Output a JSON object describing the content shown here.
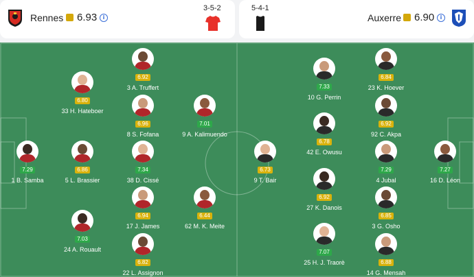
{
  "home": {
    "name": "Rennes",
    "rating": "6.93",
    "formation": "3-5-2",
    "shirt_color": "#e8312a",
    "players": [
      {
        "num": "3",
        "name": "A. Truffert",
        "rating": "6.92",
        "color": "yellow"
      },
      {
        "num": "33",
        "name": "H. Hateboer",
        "rating": "6.80",
        "color": "yellow"
      },
      {
        "num": "8",
        "name": "S. Fofana",
        "rating": "6.96",
        "color": "yellow"
      },
      {
        "num": "9",
        "name": "A. Kalimuendo",
        "rating": "7.01",
        "color": "green"
      },
      {
        "num": "1",
        "name": "B. Samba",
        "rating": "7.29",
        "color": "green"
      },
      {
        "num": "5",
        "name": "L. Brassier",
        "rating": "6.86",
        "color": "yellow"
      },
      {
        "num": "38",
        "name": "D. Cissé",
        "rating": "7.34",
        "color": "green"
      },
      {
        "num": "17",
        "name": "J. James",
        "rating": "6.94",
        "color": "yellow"
      },
      {
        "num": "62",
        "name": "M. K. Meite",
        "rating": "6.44",
        "color": "yellow"
      },
      {
        "num": "24",
        "name": "A. Rouault",
        "rating": "7.03",
        "color": "green"
      },
      {
        "num": "22",
        "name": "L. Assignon",
        "rating": "6.82",
        "color": "yellow"
      }
    ]
  },
  "away": {
    "name": "Auxerre",
    "rating": "6.90",
    "formation": "5-4-1",
    "shirt_color": "#1a1a1a",
    "players": [
      {
        "num": "10",
        "name": "G. Perrin",
        "rating": "7.33",
        "color": "green"
      },
      {
        "num": "23",
        "name": "K. Hoever",
        "rating": "6.84",
        "color": "yellow"
      },
      {
        "num": "42",
        "name": "E. Owusu",
        "rating": "6.78",
        "color": "yellow"
      },
      {
        "num": "92",
        "name": "C. Akpa",
        "rating": "6.92",
        "color": "yellow"
      },
      {
        "num": "9",
        "name": "T. Bair",
        "rating": "6.73",
        "color": "yellow"
      },
      {
        "num": "4",
        "name": "Jubal",
        "rating": "7.29",
        "color": "green"
      },
      {
        "num": "16",
        "name": "D. Léon",
        "rating": "7.27",
        "color": "green"
      },
      {
        "num": "27",
        "name": "K. Danois",
        "rating": "6.92",
        "color": "yellow"
      },
      {
        "num": "3",
        "name": "G. Osho",
        "rating": "6.85",
        "color": "yellow"
      },
      {
        "num": "25",
        "name": "H. J. Traorè",
        "rating": "7.07",
        "color": "green"
      },
      {
        "num": "14",
        "name": "G. Mensah",
        "rating": "6.88",
        "color": "yellow"
      }
    ]
  },
  "colors": {
    "pitch": "#3d8c5a",
    "rating_yellow": "#d9b20c",
    "rating_green": "#2ea84a",
    "info_blue": "#3b6fd8"
  }
}
